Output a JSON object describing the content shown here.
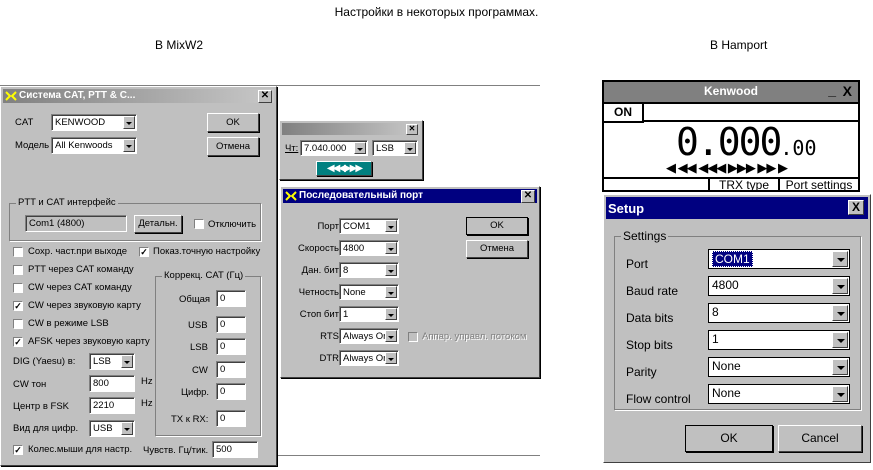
{
  "header": {
    "title": "Настройки в некоторых программах.",
    "left_caption": "В MixW2",
    "right_caption": "В Hamport"
  },
  "cat_window": {
    "title": "Система CAT, PTT & C...",
    "cat_label": "CAT",
    "cat_value": "KENWOOD",
    "model_label": "Модель",
    "model_value": "All Kenwoods",
    "ok": "OK",
    "cancel": "Отмена",
    "ptt_group": "PTT и CAT интерфейс",
    "port_display": "Com1 (4800)",
    "details": "Детальн.",
    "disable": "Отключить",
    "save_freq": "Сохр. част.при выходе",
    "show_exact": "Показ.точную настройку",
    "ptt_cat": "PTT через CAT команду",
    "cw_cat": "CW через CAT команду",
    "cw_sound": "CW через звуковую карту",
    "cw_lsb": "CW в режиме LSB",
    "afsk_sound": "AFSK через звуковую карту",
    "dig_label": "DIG (Yaesu) в:",
    "dig_value": "LSB",
    "cw_tone_label": "CW тон",
    "cw_tone_value": "800",
    "hz1": "Hz",
    "fsk_label": "Центр в FSK",
    "fsk_value": "2210",
    "hz2": "Hz",
    "view_label": "Вид для цифр.",
    "view_value": "USB",
    "wheel": "Колес.мыши для настр.",
    "sens_label": "Чувств. Гц/тик.",
    "sens_value": "500",
    "corr_group": "Коррекц. CAT (Гц)",
    "corr": [
      {
        "label": "Общая",
        "value": "0"
      },
      {
        "label": "USB",
        "value": "0"
      },
      {
        "label": "LSB",
        "value": "0"
      },
      {
        "label": "CW",
        "value": "0"
      },
      {
        "label": "Цифр.",
        "value": "0"
      },
      {
        "label": "TX к RX:",
        "value": "0"
      }
    ]
  },
  "freq_window": {
    "freq_label": "Чт:",
    "freq_value": "7.040.000",
    "mode_value": "LSB",
    "arrows": "◀◀◀▶▶▶"
  },
  "serial_window": {
    "title": "Последовательный порт",
    "ok": "OK",
    "cancel": "Отмена",
    "rows": [
      {
        "label": "Порт",
        "value": "COM1"
      },
      {
        "label": "Скорость",
        "value": "4800"
      },
      {
        "label": "Дан. бит",
        "value": "8"
      },
      {
        "label": "Четность",
        "value": "None"
      },
      {
        "label": "Стоп бит",
        "value": "1"
      },
      {
        "label": "RTS",
        "value": "Always On"
      },
      {
        "label": "DTR",
        "value": "Always On"
      }
    ],
    "hw_flow": "Аппар. управл. потоком"
  },
  "kenwood_window": {
    "title": "Kenwood",
    "minimize": "_",
    "close": "X",
    "on_label": "ON",
    "freq_main": "0.000",
    "freq_small": ".00",
    "arrows": "◀ ◀◀ ◀◀◀ ▶▶▶ ▶▶ ▶",
    "trx_type": "TRX type",
    "port_settings": "Port settings"
  },
  "setup_window": {
    "title": "Setup",
    "close": "X",
    "group": "Settings",
    "rows": [
      {
        "label": "Port",
        "value": "COM1"
      },
      {
        "label": "Baud rate",
        "value": "4800"
      },
      {
        "label": "Data bits",
        "value": "8"
      },
      {
        "label": "Stop bits",
        "value": "1"
      },
      {
        "label": "Parity",
        "value": "None"
      },
      {
        "label": "Flow control",
        "value": "None"
      }
    ],
    "ok": "OK",
    "cancel": "Cancel"
  },
  "colors": {
    "title_active": "#000080",
    "face": "#c0c0c0",
    "teal_arrows": "#008080"
  }
}
